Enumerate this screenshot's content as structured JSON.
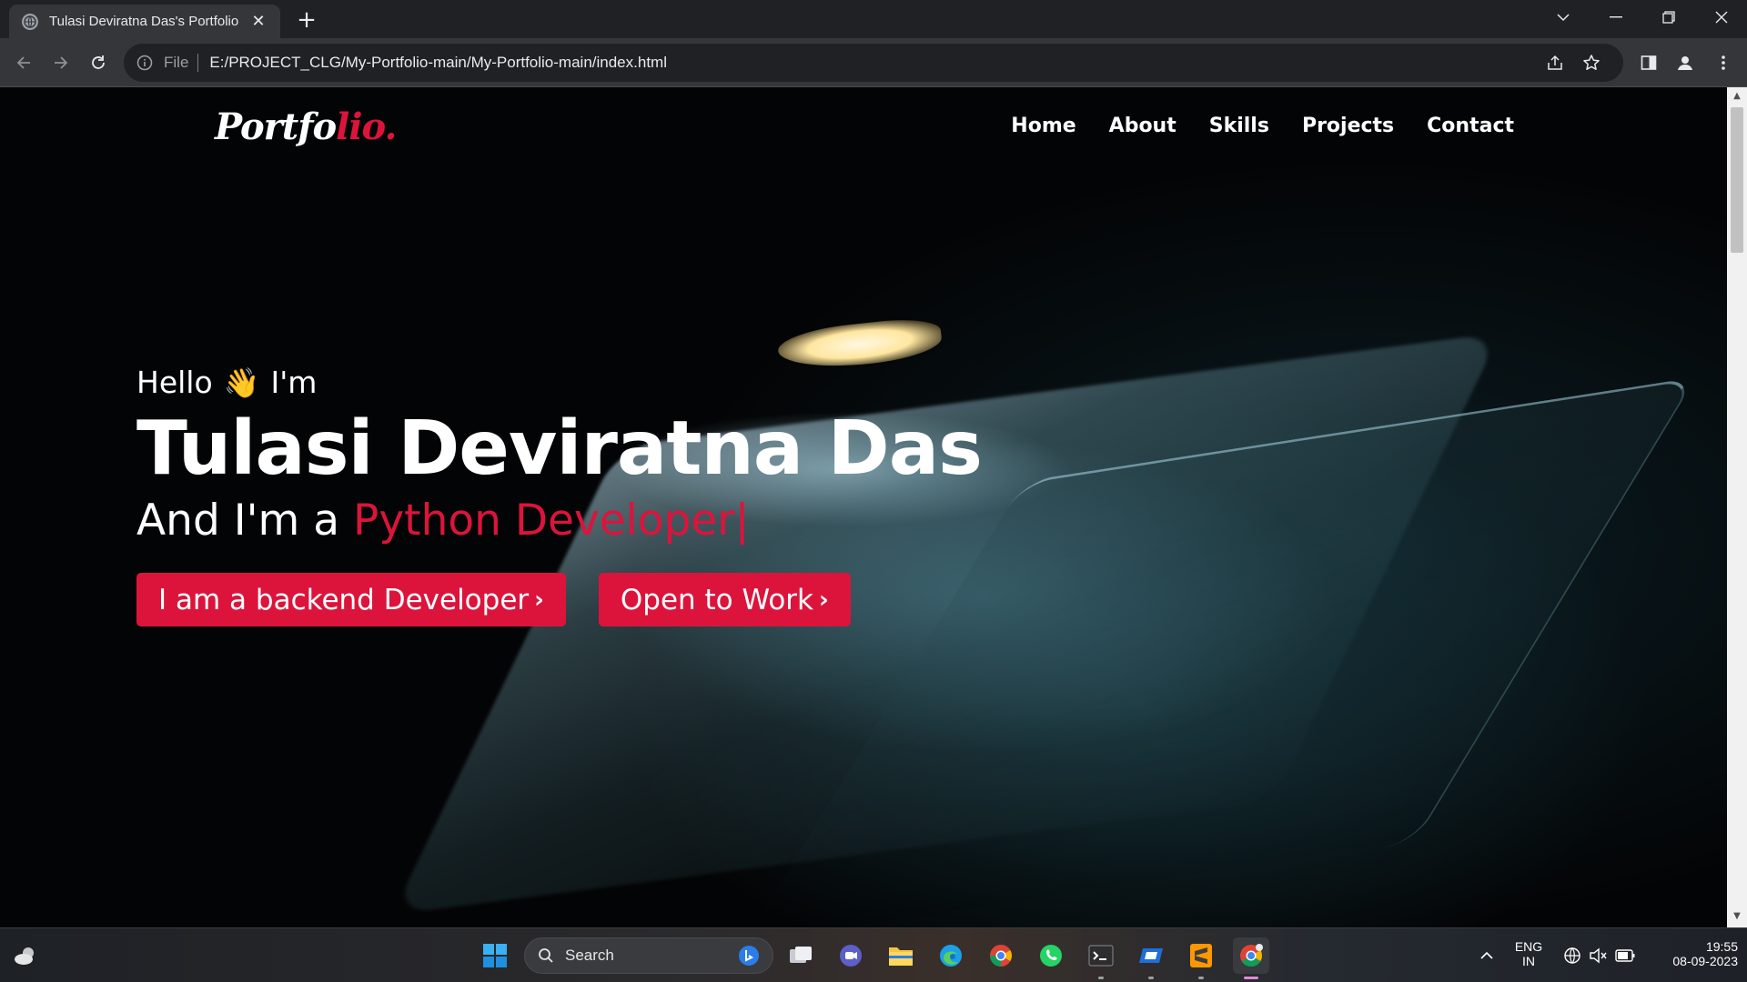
{
  "browser": {
    "tab_title": "Tulasi Deviratna Das's Portfolio",
    "close_glyph": "✕",
    "newtab_glyph": "+",
    "omnibox_scheme": "File",
    "omnibox_url": "E:/PROJECT_CLG/My-Portfolio-main/My-Portfolio-main/index.html"
  },
  "site": {
    "logo_main": "Portfo",
    "logo_accent": "lio.",
    "nav": [
      "Home",
      "About",
      "Skills",
      "Projects",
      "Contact"
    ],
    "hello_pre": "Hello",
    "hello_emoji": "👋",
    "hello_post": "I'm",
    "name": "Tulasi Deviratna Das",
    "role_prefix": "And I'm a",
    "role_typed": "Python Developer",
    "cursor": "|",
    "buttons": [
      "I am a backend Developer",
      "Open to Work"
    ],
    "chevron": "›",
    "accent_color": "#dc143c"
  },
  "taskbar": {
    "search_label": "Search",
    "lang_line1": "ENG",
    "lang_line2": "IN",
    "time": "19:55",
    "date": "08-09-2023"
  }
}
